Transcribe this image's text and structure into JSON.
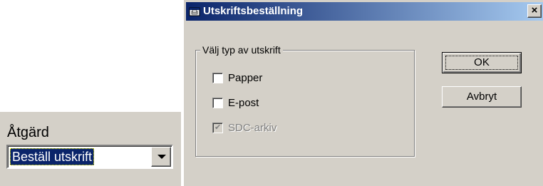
{
  "action": {
    "label": "Åtgärd",
    "selected_value": "Beställ utskrift"
  },
  "dialog": {
    "title": "Utskriftsbeställning",
    "close_glyph": "×",
    "group": {
      "legend": "Välj typ av utskrift",
      "options": [
        {
          "label": "Papper",
          "checked": false,
          "enabled": true
        },
        {
          "label": "E-post",
          "checked": false,
          "enabled": true
        },
        {
          "label": "SDC-arkiv",
          "checked": true,
          "enabled": false
        }
      ]
    },
    "buttons": {
      "ok": "OK",
      "cancel": "Avbryt"
    }
  },
  "colors": {
    "face": "#d4d0c8",
    "titlebar_start": "#0a246a",
    "titlebar_end": "#a6caf0",
    "selection": "#0a246a"
  },
  "icons": {
    "title": "printer-window-icon",
    "check": "checkmark-icon",
    "dropdown": "chevron-down-icon"
  }
}
